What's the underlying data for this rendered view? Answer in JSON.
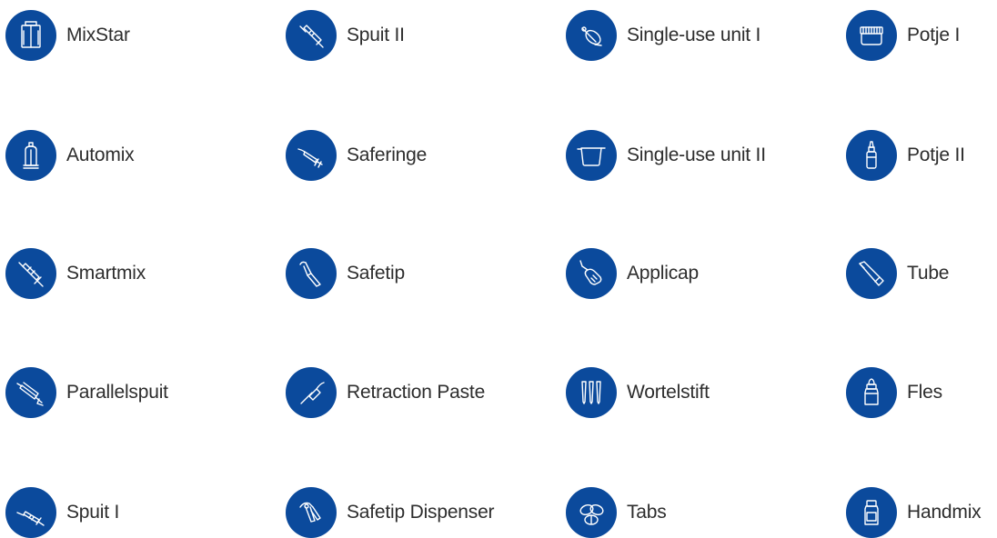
{
  "products": [
    {
      "label": "MixStar",
      "icon": "mixstar-icon"
    },
    {
      "label": "Spuit II",
      "icon": "syringe-icon"
    },
    {
      "label": "Single-use unit I",
      "icon": "single-use-unit-icon"
    },
    {
      "label": "Potje I",
      "icon": "jar-icon"
    },
    {
      "label": "Automix",
      "icon": "automix-cartridge-icon"
    },
    {
      "label": "Saferinge",
      "icon": "safe-syringe-icon"
    },
    {
      "label": "Single-use unit II",
      "icon": "cup-icon"
    },
    {
      "label": "Potje II",
      "icon": "bottle-icon"
    },
    {
      "label": "Smartmix",
      "icon": "smartmix-syringe-icon"
    },
    {
      "label": "Safetip",
      "icon": "safetip-icon"
    },
    {
      "label": "Applicap",
      "icon": "capsule-icon"
    },
    {
      "label": "Tube",
      "icon": "tube-icon"
    },
    {
      "label": "Parallelspuit",
      "icon": "parallel-syringe-icon"
    },
    {
      "label": "Retraction Paste",
      "icon": "retraction-paste-icon"
    },
    {
      "label": "Wortelstift",
      "icon": "root-post-icon"
    },
    {
      "label": "Fles",
      "icon": "dropper-bottle-icon"
    },
    {
      "label": "Spuit I",
      "icon": "syringe-small-icon"
    },
    {
      "label": "Safetip Dispenser",
      "icon": "dispenser-gun-icon"
    },
    {
      "label": "Tabs",
      "icon": "tablets-icon"
    },
    {
      "label": "Handmix",
      "icon": "handmix-jar-icon"
    }
  ],
  "colors": {
    "icon_background": "#0b4a9c",
    "text": "#2d2d2d"
  }
}
